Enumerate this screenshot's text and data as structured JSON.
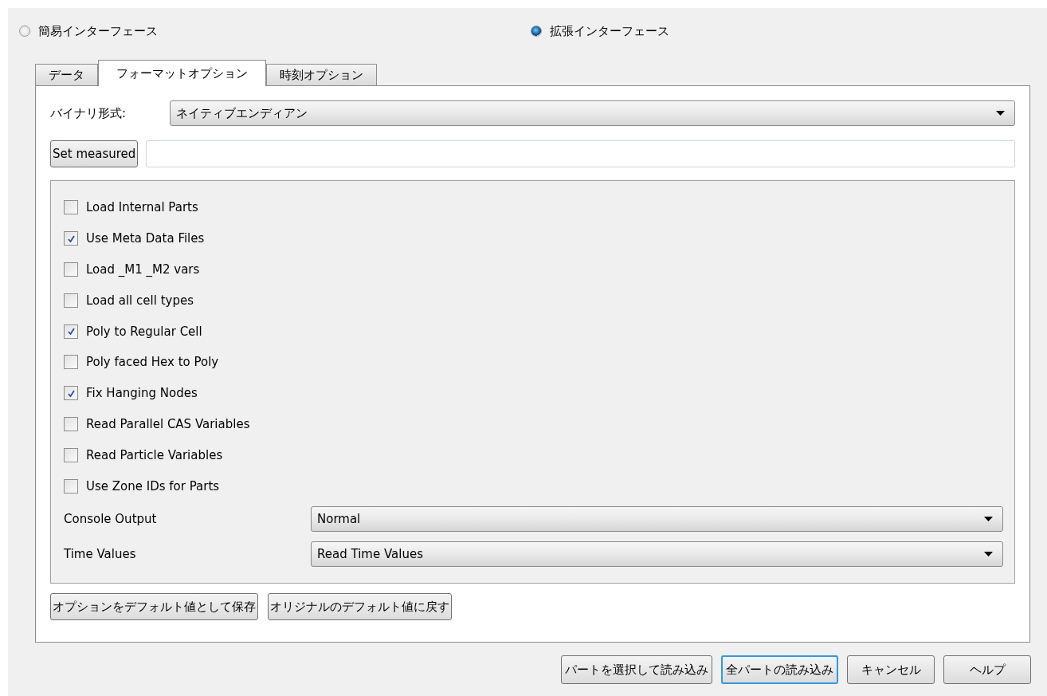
{
  "interface_modes": [
    {
      "label": "簡易インターフェース",
      "selected": false
    },
    {
      "label": "拡張インターフェース",
      "selected": true
    }
  ],
  "tabs": [
    {
      "label": "データ",
      "selected": false
    },
    {
      "label": "フォーマットオプション",
      "selected": true
    },
    {
      "label": "時刻オプション",
      "selected": false
    }
  ],
  "binary_format": {
    "label": "バイナリ形式:",
    "value": "ネイティブエンディアン"
  },
  "set_measured": {
    "button": "Set measured"
  },
  "options": [
    {
      "label": "Load Internal Parts",
      "checked": false
    },
    {
      "label": "Use Meta Data Files",
      "checked": true
    },
    {
      "label": "Load _M1 _M2 vars",
      "checked": false
    },
    {
      "label": "Load all cell types",
      "checked": false
    },
    {
      "label": "Poly to Regular Cell",
      "checked": true
    },
    {
      "label": "Poly faced Hex to Poly",
      "checked": false
    },
    {
      "label": "Fix Hanging Nodes",
      "checked": true
    },
    {
      "label": "Read Parallel CAS Variables",
      "checked": false
    },
    {
      "label": "Read Particle Variables",
      "checked": false
    },
    {
      "label": "Use Zone IDs for Parts",
      "checked": false
    }
  ],
  "selects": [
    {
      "label": "Console Output",
      "value": "Normal"
    },
    {
      "label": "Time Values",
      "value": "Read Time Values"
    }
  ],
  "default_buttons": [
    "オプションをデフォルト値として保存",
    "オリジナルのデフォルト値に戻す"
  ],
  "dialog_buttons": [
    {
      "label": "パートを選択して読み込み",
      "default": false
    },
    {
      "label": "全パートの読み込み",
      "default": true
    },
    {
      "label": "キャンセル",
      "default": false
    },
    {
      "label": "ヘルプ",
      "default": false
    }
  ]
}
